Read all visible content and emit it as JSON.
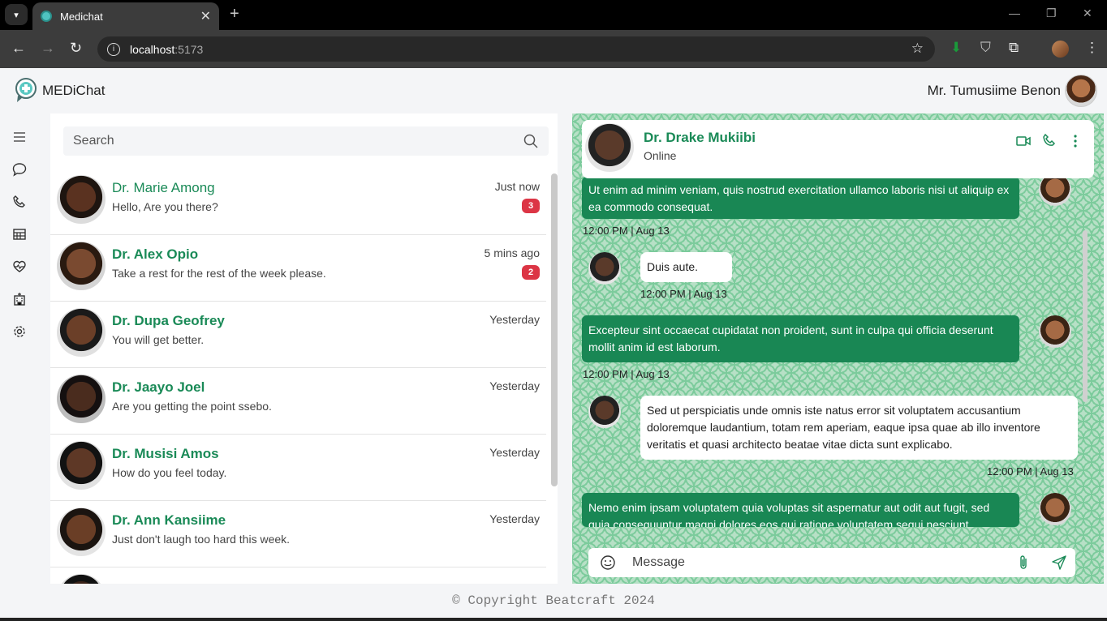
{
  "browser": {
    "tab_title": "Medichat",
    "url_host": "localhost",
    "url_port": ":5173"
  },
  "header": {
    "app_name": "MEDiChat",
    "user_name": "Mr. Tumusiime Benon"
  },
  "search": {
    "placeholder": "Search"
  },
  "contacts": [
    {
      "name": "Dr. Marie Among",
      "message": "Hello, Are you there?",
      "time": "Just now",
      "badge": "3"
    },
    {
      "name": "Dr. Alex Opio",
      "message": "Take a rest for the rest of the week please.",
      "time": "5 mins ago",
      "badge": "2"
    },
    {
      "name": "Dr. Dupa Geofrey",
      "message": "You will get better.",
      "time": "Yesterday",
      "badge": ""
    },
    {
      "name": "Dr. Jaayo Joel",
      "message": "Are you getting the point ssebo.",
      "time": "Yesterday",
      "badge": ""
    },
    {
      "name": "Dr. Musisi Amos",
      "message": "How do you feel today.",
      "time": "Yesterday",
      "badge": ""
    },
    {
      "name": "Dr. Ann Kansiime",
      "message": "Just don't laugh too hard this week.",
      "time": "Yesterday",
      "badge": ""
    }
  ],
  "chat": {
    "contact_name": "Dr. Drake Mukiibi",
    "status": "Online",
    "messages": [
      {
        "direction": "out",
        "text": "Ut enim ad minim veniam, quis nostrud exercitation ullamco laboris nisi ut aliquip ex ea commodo consequat.",
        "time": "12:00 PM | Aug 13"
      },
      {
        "direction": "in",
        "text": "Duis aute.",
        "time": "12:00 PM | Aug 13"
      },
      {
        "direction": "out",
        "text": "Excepteur sint occaecat cupidatat non proident, sunt in culpa qui officia deserunt mollit anim id est laborum.",
        "time": "12:00 PM | Aug 13"
      },
      {
        "direction": "in",
        "text": "Sed ut perspiciatis unde omnis iste natus error sit voluptatem accusantium doloremque laudantium, totam rem aperiam, eaque ipsa quae ab illo inventore veritatis et quasi architecto beatae vitae dicta sunt explicabo.",
        "time": "12:00 PM | Aug 13"
      },
      {
        "direction": "out",
        "text": "Nemo enim ipsam voluptatem quia voluptas sit aspernatur aut odit aut fugit, sed quia consequuntur magni dolores eos qui ratione voluptatem sequi nesciunt.",
        "time": ""
      }
    ],
    "composer_placeholder": "Message"
  },
  "footer": {
    "text": "© Copyright Beatcraft 2024"
  },
  "colors": {
    "accent": "#198754",
    "name_green": "#1a8a57",
    "badge_red": "#dc3545",
    "chat_bg": "#b7e0c6"
  }
}
